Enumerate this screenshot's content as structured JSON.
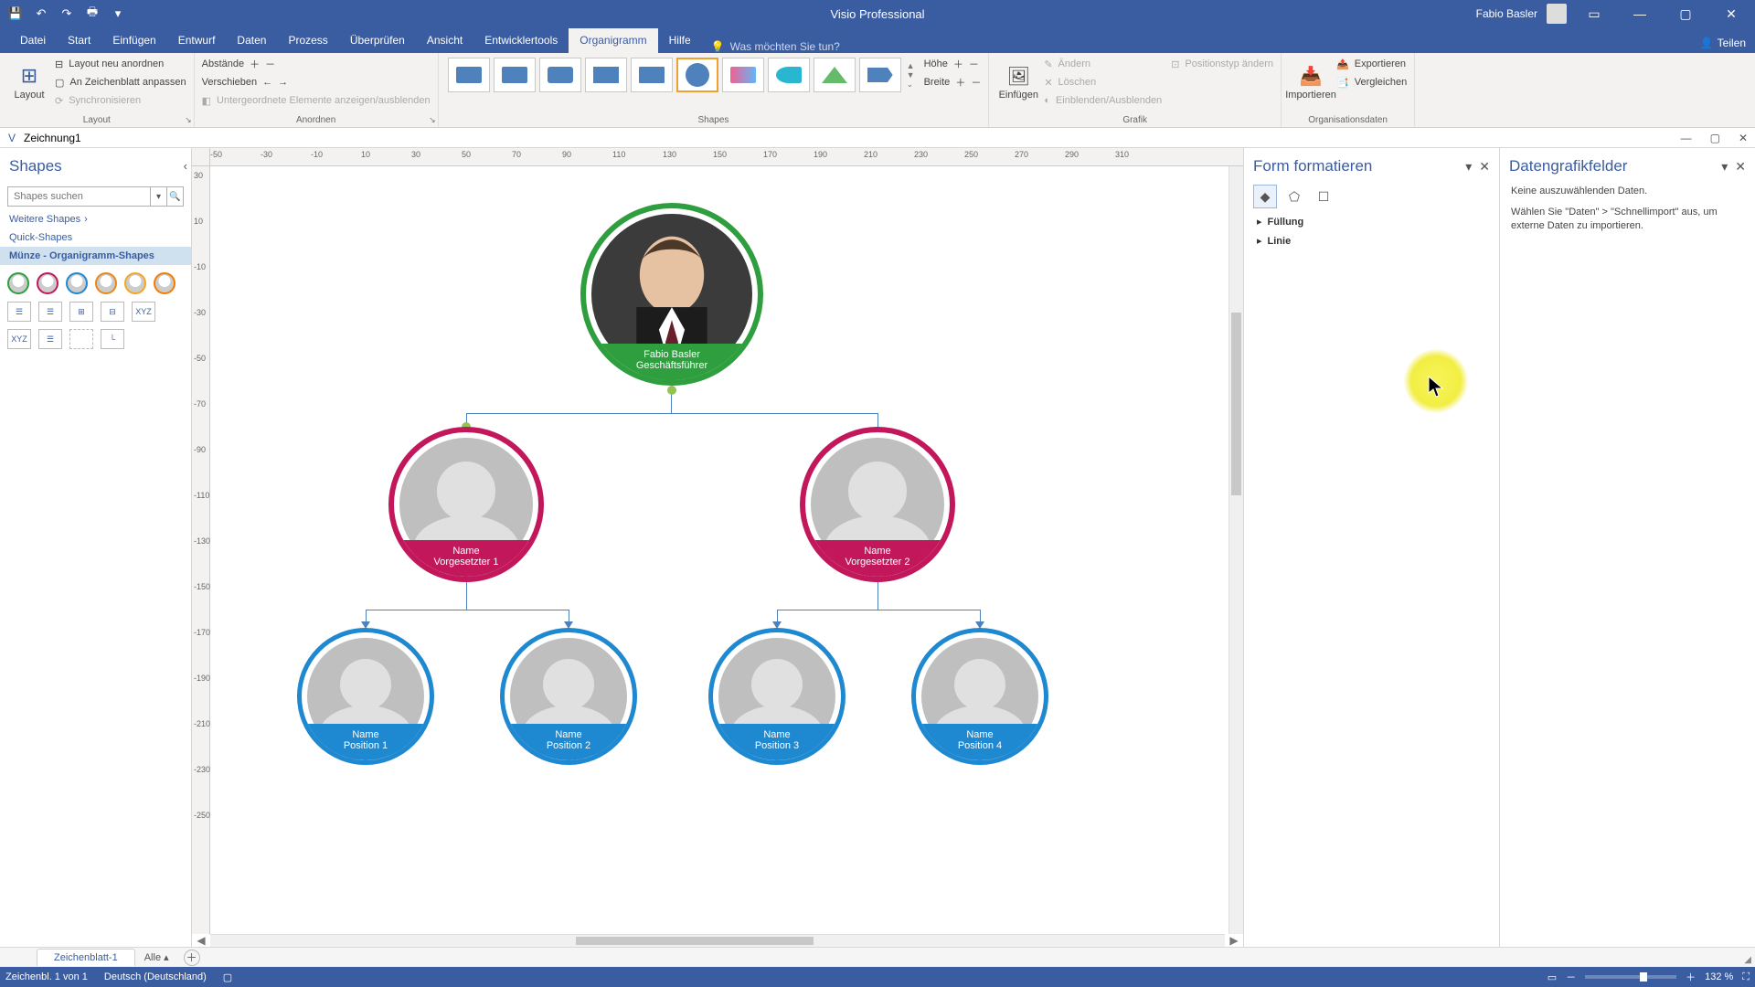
{
  "app": {
    "title": "Visio Professional",
    "user": "Fabio Basler"
  },
  "qat": {
    "save": "💾",
    "undo": "↶",
    "redo": "↷",
    "print": "🖶"
  },
  "tabs": {
    "file": "Datei",
    "start": "Start",
    "insert": "Einfügen",
    "design": "Entwurf",
    "data": "Daten",
    "process": "Prozess",
    "review": "Überprüfen",
    "view": "Ansicht",
    "devtools": "Entwicklertools",
    "orgchart": "Organigramm",
    "help": "Hilfe",
    "tellme": "Was möchten Sie tun?",
    "share": "Teilen"
  },
  "ribbon": {
    "layout_btn": "Layout",
    "layout_relayout": "Layout neu anordnen",
    "layout_fit": "An Zeichenblatt anpassen",
    "layout_sync": "Synchronisieren",
    "layout_group": "Layout",
    "arrange_spacing": "Abstände",
    "arrange_move": "Verschieben",
    "arrange_toggle": "Untergeordnete Elemente anzeigen/ausblenden",
    "arrange_group": "Anordnen",
    "shapes_group": "Shapes",
    "size_height": "Höhe",
    "size_width": "Breite",
    "insert_btn": "Einfügen",
    "pic_change": "Ändern",
    "pic_delete": "Löschen",
    "pic_show": "Einblenden/Ausblenden",
    "pic_pos": "Positionstyp ändern",
    "pic_group": "Grafik",
    "import_btn": "Importieren",
    "export_btn": "Exportieren",
    "compare_btn": "Vergleichen",
    "orgdata_group": "Organisationsdaten"
  },
  "doc": {
    "title": "Zeichnung1"
  },
  "shapes_panel": {
    "title": "Shapes",
    "search_placeholder": "Shapes suchen",
    "more": "Weitere Shapes",
    "quick": "Quick-Shapes",
    "stencil": "Münze - Organigramm-Shapes"
  },
  "org": {
    "boss": {
      "name": "Fabio Basler",
      "title": "Geschäftsführer"
    },
    "mgr1": {
      "name": "Name",
      "title": "Vorgesetzter 1"
    },
    "mgr2": {
      "name": "Name",
      "title": "Vorgesetzter 2"
    },
    "emp1": {
      "name": "Name",
      "title": "Position 1"
    },
    "emp2": {
      "name": "Name",
      "title": "Position 2"
    },
    "emp3": {
      "name": "Name",
      "title": "Position 3"
    },
    "emp4": {
      "name": "Name",
      "title": "Position 4"
    }
  },
  "format_pane": {
    "title": "Form formatieren",
    "fill": "Füllung",
    "line": "Linie"
  },
  "datagfx_pane": {
    "title": "Datengrafikfelder",
    "line1": "Keine auszuwählenden Daten.",
    "line2": "Wählen Sie \"Daten\" > \"Schnellimport\" aus, um externe Daten zu importieren."
  },
  "tabstrip": {
    "sheet": "Zeichenblatt-1",
    "all": "Alle"
  },
  "status": {
    "page": "Zeichenbl. 1 von 1",
    "lang": "Deutsch (Deutschland)",
    "zoom": "132 %"
  },
  "ruler_h": [
    "-50",
    "-30",
    "-10",
    "10",
    "30",
    "50",
    "70",
    "90",
    "110",
    "130",
    "150",
    "170",
    "190",
    "210",
    "230",
    "250",
    "270",
    "290",
    "310"
  ],
  "ruler_v": [
    "30",
    "10",
    "-10",
    "-30",
    "-50",
    "-70",
    "-90",
    "-110",
    "-130",
    "-150",
    "-170",
    "-190",
    "-210",
    "-230",
    "-250"
  ]
}
